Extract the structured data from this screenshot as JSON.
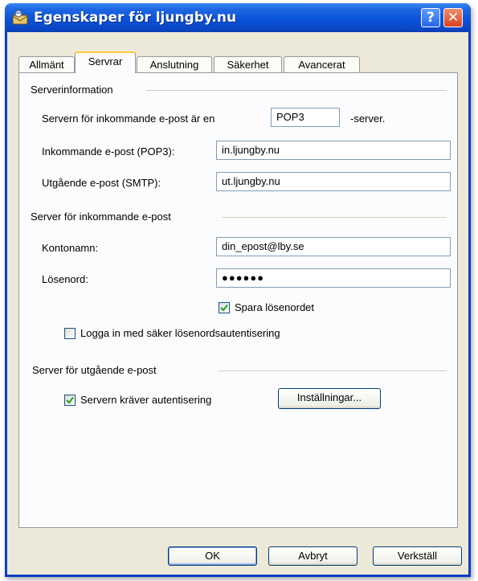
{
  "window": {
    "title": "Egenskaper för ljungby.nu",
    "help_label": "?",
    "close_label": "✕"
  },
  "tabs": [
    {
      "label": "Allmänt"
    },
    {
      "label": "Servrar",
      "active": true
    },
    {
      "label": "Anslutning"
    },
    {
      "label": "Säkerhet"
    },
    {
      "label": "Avancerat"
    }
  ],
  "serverinfo": {
    "heading": "Serverinformation",
    "incoming_type_prefix": "Servern för inkommande e-post är en",
    "incoming_type_value": "POP3",
    "incoming_type_suffix": "-server.",
    "incoming_label": "Inkommande e-post (POP3):",
    "incoming_value": "in.ljungby.nu",
    "outgoing_label": "Utgående e-post (SMTP):",
    "outgoing_value": "ut.ljungby.nu"
  },
  "incoming": {
    "heading": "Server för inkommande e-post",
    "account_label": "Kontonamn:",
    "account_value": "din_epost@lby.se",
    "password_label": "Lösenord:",
    "password_value": "●●●●●●",
    "save_password_label": "Spara lösenordet",
    "save_password_checked": true,
    "spa_label": "Logga in med säker lösenordsautentisering",
    "spa_checked": false
  },
  "outgoing": {
    "heading": "Server för utgående e-post",
    "auth_label": "Servern kräver autentisering",
    "auth_checked": true,
    "settings_label": "Inställningar..."
  },
  "footer": {
    "ok_label": "OK",
    "cancel_label": "Avbryt",
    "apply_label": "Verkställ"
  },
  "colors": {
    "titlebar": "#0b53d9",
    "dialog_bg": "#ece9d8",
    "active_tab_accent": "#ffc83c",
    "checkmark": "#21a121"
  }
}
